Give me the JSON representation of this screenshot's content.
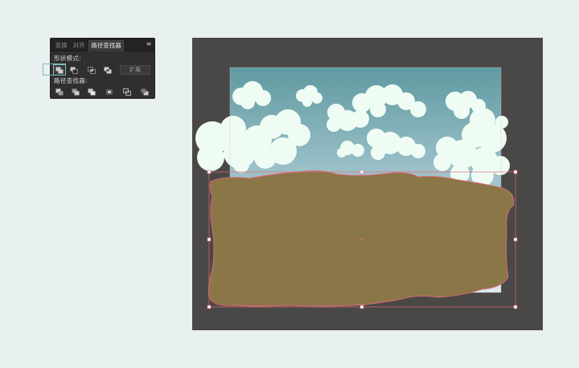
{
  "panel": {
    "tabs": [
      "变换",
      "对齐",
      "路径查找器"
    ],
    "active_tab": "路径查找器",
    "menu_icon": "panel-menu-icon",
    "shape_modes_label": "形状模式:",
    "expand_label": "扩展",
    "pathfinders_label": "路径查找器:",
    "shape_mode_icons": [
      "unite-icon",
      "minus-front-icon",
      "intersect-icon",
      "exclude-icon"
    ],
    "pathfinder_icons": [
      "divide-icon",
      "trim-icon",
      "merge-icon",
      "crop-icon",
      "outline-icon",
      "minus-back-icon"
    ]
  },
  "colors": {
    "page_background": "#e9f0f0",
    "artboard": "#4a4847",
    "sky_top": "#5f9aa2",
    "sky_bottom": "#d9e6ec",
    "cloud": "#eefcf4",
    "ground": "#8a7647",
    "selection": "#e06b7a",
    "highlight": "#7bb9b6"
  }
}
